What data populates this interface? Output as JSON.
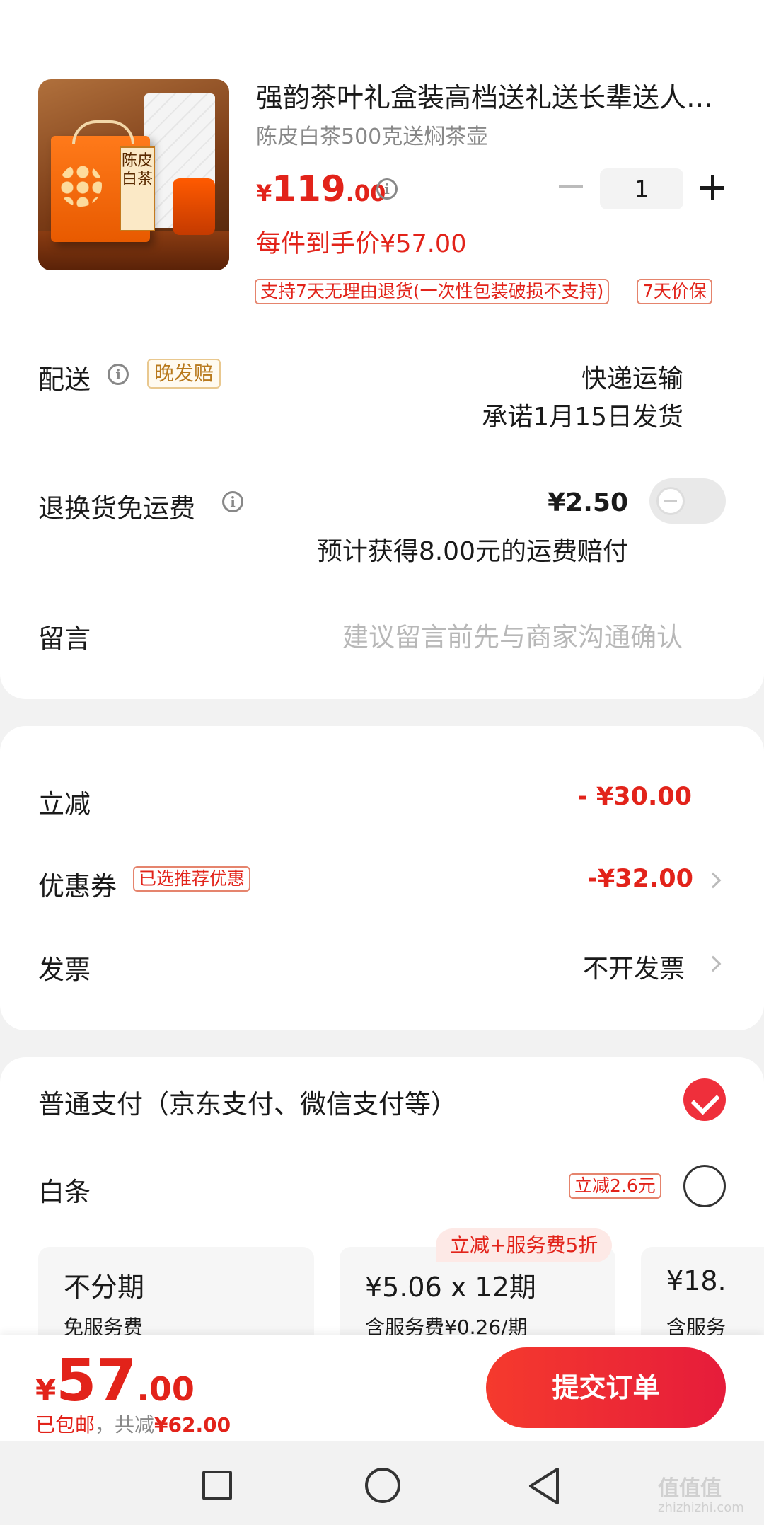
{
  "product": {
    "title": "强韵茶叶礼盒装高档送礼送长辈送人…",
    "subtitle": "陈皮白茶500克送焖茶壶",
    "image_label": "陈皮白茶",
    "price_currency": "¥",
    "price_int": "119",
    "price_dec": ".00",
    "unit_price": "每件到手价¥57.00",
    "quantity": "1",
    "tags": [
      "支持7天无理由退货(一次性包装破损不支持)",
      "7天价保"
    ]
  },
  "delivery": {
    "label": "配送",
    "badge": "晚发赔",
    "method": "快递运输",
    "promise": "承诺1月15日发货"
  },
  "return_shipping": {
    "label": "退换货免运费",
    "price": "¥2.50",
    "note": "预计获得8.00元的运费赔付"
  },
  "message": {
    "label": "留言",
    "placeholder": "建议留言前先与商家沟通确认"
  },
  "discounts": {
    "instant_label": "立减",
    "instant_amount": "- ¥30.00",
    "coupon_label": "优惠券",
    "coupon_badge": "已选推荐优惠",
    "coupon_amount": "-¥32.00",
    "invoice_label": "发票",
    "invoice_value": "不开发票"
  },
  "payment": {
    "normal_label": "普通支付（京东支付、微信支付等）",
    "baitiao_label": "白条",
    "baitiao_badge": "立减2.6元",
    "promo_badge": "立减+服务费5折",
    "plans": [
      {
        "main": "不分期",
        "sub": "免服务费"
      },
      {
        "main": "¥5.06 x 12期",
        "sub": "含服务费¥0.26/期"
      },
      {
        "main": "¥18.",
        "sub": "含服务"
      }
    ]
  },
  "footer": {
    "total_currency": "¥",
    "total_int": "57",
    "total_dec": ".00",
    "shipping_note": "已包邮",
    "separator": "，",
    "saved_label": "共减",
    "saved_amount": "¥62.00",
    "submit_label": "提交订单"
  },
  "watermark": {
    "logo": "值值值",
    "site": "zhizhizhi.com"
  },
  "colors": {
    "accent": "#e2231a",
    "submit_gradient_start": "#f53a2d",
    "submit_gradient_end": "#e61c3b"
  }
}
